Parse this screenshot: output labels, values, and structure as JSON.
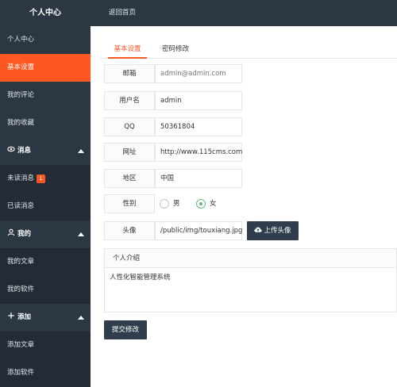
{
  "header": {
    "title": "个人中心",
    "home_link": "返回首页"
  },
  "sidebar": {
    "items": [
      {
        "label": "个人中心"
      },
      {
        "label": "基本设置"
      },
      {
        "label": "我的评论"
      },
      {
        "label": "我的收藏"
      }
    ],
    "groups": [
      {
        "label": "消息",
        "icon": "eye-icon",
        "subitems": [
          {
            "label": "未读消息",
            "badge": "1"
          },
          {
            "label": "已读消息"
          }
        ]
      },
      {
        "label": "我的",
        "icon": "user-icon",
        "subitems": [
          {
            "label": "我的文章"
          },
          {
            "label": "我的软件"
          }
        ]
      },
      {
        "label": "添加",
        "icon": "plus-icon",
        "subitems": [
          {
            "label": "添加文章"
          },
          {
            "label": "添加软件"
          }
        ]
      }
    ]
  },
  "tabs": [
    {
      "label": "基本设置"
    },
    {
      "label": "密码修改"
    }
  ],
  "form": {
    "email": {
      "label": "邮箱",
      "placeholder": "admin@admin.com"
    },
    "username": {
      "label": "用户名",
      "value": "admin"
    },
    "qq": {
      "label": "QQ",
      "value": "50361804"
    },
    "website": {
      "label": "网址",
      "value": "http://www.115cms.com"
    },
    "region": {
      "label": "地区",
      "value": "中国"
    },
    "gender": {
      "label": "性别",
      "options": [
        "男",
        "女"
      ],
      "selected": "女"
    },
    "avatar": {
      "label": "头像",
      "value": "/public/img/touxiang.jpg",
      "upload_label": "上传头像",
      "upload_icon": "cloud-upload-icon"
    },
    "intro": {
      "label": "个人介绍",
      "value": "人性化智能管理系统"
    },
    "submit_label": "提交修改"
  },
  "colors": {
    "sidebar_bg": "#2c3744",
    "accent": "#ff5722",
    "radio_checked": "#5fb878",
    "button_bg": "#2f3d4d"
  }
}
